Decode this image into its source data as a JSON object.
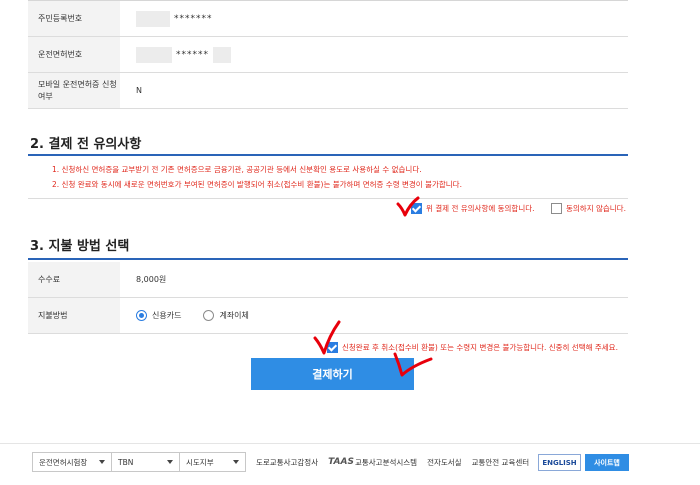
{
  "info": {
    "resident_label": "주민등록번호",
    "resident_value": "*******",
    "license_label": "운전면허번호",
    "license_value": "******",
    "mobile_label": "모바일 운전면허증 신청여부",
    "mobile_value": "N"
  },
  "section1": {
    "title": "2. 결제 전 유의사항",
    "notices": [
      "1. 신청하신 면허증을 교부받기 전 기존 면허증으로 금융기관, 공공기관 등에서 신분확인 용도로 사용하실 수 없습니다.",
      "2. 신청 완료와 동시에 새로운 면허번호가 부여된 면허증이 발행되어 취소(접수비 환불)는 불가하며 면허증 수령 변경이 불가합니다."
    ],
    "agree_label": "위 결제 전 유의사항에 동의합니다.",
    "agree_checked": true,
    "disagree_label": "동의하지 않습니다.",
    "disagree_checked": false
  },
  "section2": {
    "title": "3. 지불 방법 선택",
    "fee_label": "수수료",
    "fee_value": "8,000원",
    "method_label": "지불방법",
    "method_options": [
      "신용카드",
      "계좌이체"
    ],
    "method_selected": "신용카드",
    "refund_notice": "신청완료 후 취소(접수비 환불) 또는 수령지 변경은 불가능합니다. 신중히 선택해 주세요.",
    "refund_checked": true
  },
  "pay_button_label": "결제하기",
  "footer": {
    "select1": "운전면허시험장",
    "select2": "TBN",
    "select3": "시도지부",
    "links": [
      "도로교통사고감정사",
      "교통사고분석시스템",
      "전자도서실",
      "교통안전 교육센터"
    ],
    "taas_logo": "TAAS",
    "english_label": "ENGLISH",
    "sitemap_label": "사이트맵"
  },
  "colors": {
    "accent": "#2f8de4",
    "notice_red": "#e0281c",
    "annotation_red": "#e8000b",
    "section_line": "#2a64b8"
  },
  "icons": [
    "checkbox-icon",
    "radio-icon",
    "chevron-down-icon",
    "red-checkmark-annotation"
  ]
}
